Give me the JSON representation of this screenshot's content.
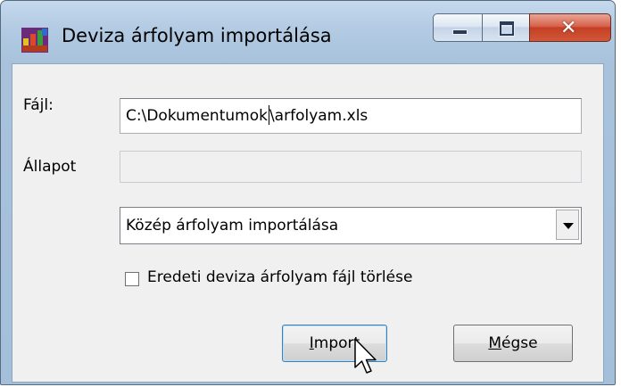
{
  "window": {
    "title": "Deviza árfolyam importálása",
    "icon": "app-icon",
    "controls": [
      "minimize-icon",
      "maximize-icon",
      "close-icon"
    ]
  },
  "form": {
    "file_label": "Fájl:",
    "file_path_before_caret": "C:\\Dokumentumok",
    "file_path_after_caret": "\\arfolyam.xls",
    "status_label": "Állapot",
    "status_value": "",
    "import_mode_selected": "Közép árfolyam importálása",
    "delete_checkbox_label": "Eredeti deviza árfolyam fájl törlése",
    "delete_checkbox_checked": false
  },
  "buttons": {
    "import_mnemonic": "I",
    "import_rest": "mport",
    "cancel_mnemonic": "M",
    "cancel_rest": "égse"
  },
  "colors": {
    "close_button": "#c43f23",
    "title_bar": "#b3cbe3",
    "dialog_face": "#f0f0f0"
  }
}
